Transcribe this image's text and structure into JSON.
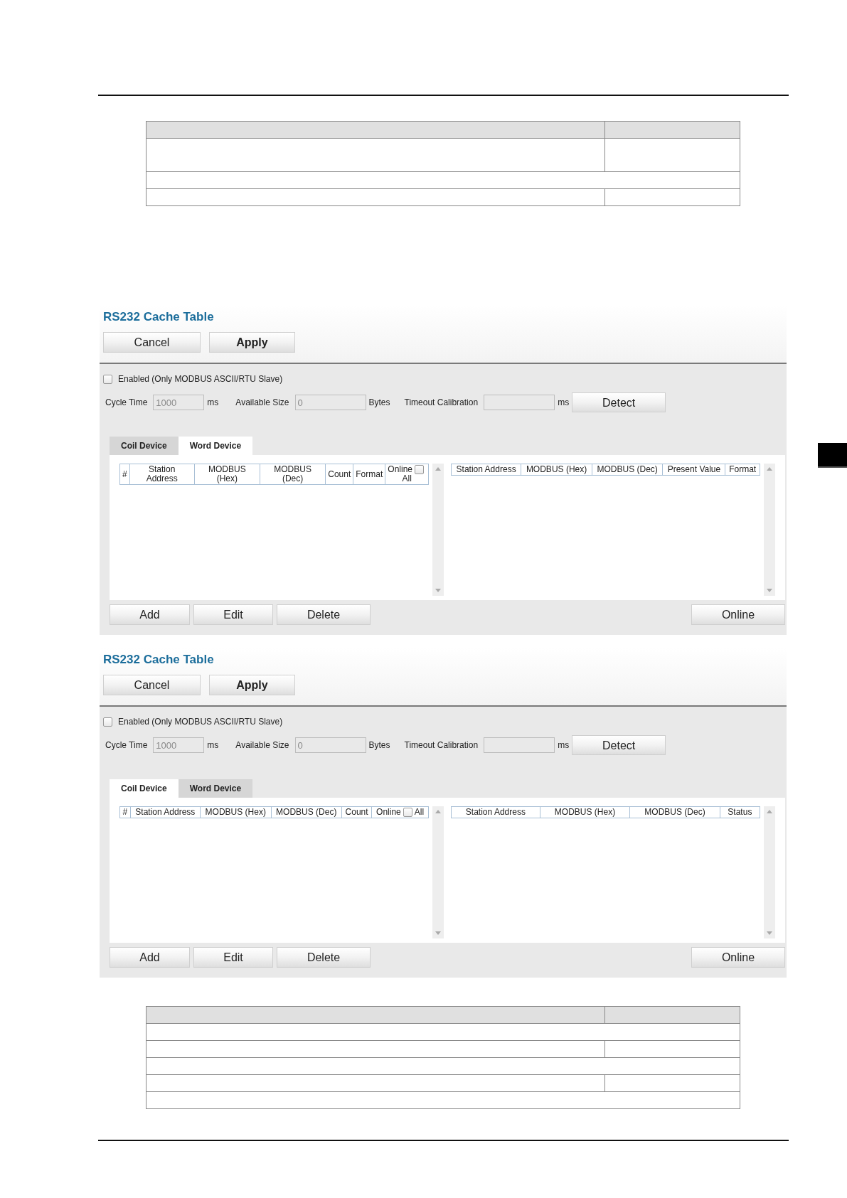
{
  "doc_tables": [
    {
      "rows": [
        {
          "kind": "header"
        },
        {
          "kind": "tall"
        },
        {
          "kind": "full"
        },
        {
          "kind": "split"
        }
      ]
    },
    {
      "rows": [
        {
          "kind": "header"
        },
        {
          "kind": "full"
        },
        {
          "kind": "split"
        },
        {
          "kind": "full"
        },
        {
          "kind": "split"
        },
        {
          "kind": "full"
        }
      ]
    }
  ],
  "panels": [
    {
      "title": "RS232 Cache Table",
      "top_buttons": [
        {
          "label": "Cancel",
          "primary": false
        },
        {
          "label": "Apply",
          "primary": true
        }
      ],
      "enabled": {
        "label": "Enabled (Only MODBUS ASCII/RTU Slave)",
        "checked": false
      },
      "fields": [
        {
          "label": "Cycle Time",
          "value": "1000",
          "unit": "ms"
        },
        {
          "label": "Available Size",
          "value": "0",
          "unit": "Bytes"
        },
        {
          "label": "Timeout Calibration",
          "unit": "ms"
        }
      ],
      "detect_button": "Detect",
      "tabs": [
        {
          "label": "Coil Device",
          "selected": false
        },
        {
          "label": "Word Device",
          "selected": true
        }
      ],
      "left_columns": [
        {
          "kind": "text",
          "label": "#"
        },
        {
          "kind": "text",
          "label": "Station Address"
        },
        {
          "kind": "text",
          "label": "MODBUS (Hex)"
        },
        {
          "kind": "text",
          "label": "MODBUS (Dec)"
        },
        {
          "kind": "text",
          "label": "Count"
        },
        {
          "kind": "text",
          "label": "Format"
        },
        {
          "kind": "check",
          "label": "Online",
          "after": "All",
          "checked": false,
          "stacked": true
        }
      ],
      "right_columns": [
        {
          "label": "Station Address"
        },
        {
          "label": "MODBUS (Hex)"
        },
        {
          "label": "MODBUS (Dec)"
        },
        {
          "label": "Present Value"
        },
        {
          "label": "Format"
        }
      ],
      "bottom_buttons": [
        "Add",
        "Edit",
        "Delete"
      ],
      "online_button": "Online"
    },
    {
      "title": "RS232 Cache Table",
      "top_buttons": [
        {
          "label": "Cancel",
          "primary": false
        },
        {
          "label": "Apply",
          "primary": true
        }
      ],
      "enabled": {
        "label": "Enabled (Only MODBUS ASCII/RTU Slave)",
        "checked": false
      },
      "fields": [
        {
          "label": "Cycle Time",
          "value": "1000",
          "unit": "ms"
        },
        {
          "label": "Available Size",
          "value": "0",
          "unit": "Bytes"
        },
        {
          "label": "Timeout Calibration",
          "unit": "ms"
        }
      ],
      "detect_button": "Detect",
      "tabs": [
        {
          "label": "Coil Device",
          "selected": true
        },
        {
          "label": "Word Device",
          "selected": false
        }
      ],
      "left_columns": [
        {
          "kind": "text",
          "label": "#"
        },
        {
          "kind": "text",
          "label": "Station Address"
        },
        {
          "kind": "text",
          "label": "MODBUS (Hex)"
        },
        {
          "kind": "text",
          "label": "MODBUS (Dec)"
        },
        {
          "kind": "text",
          "label": "Count"
        },
        {
          "kind": "check",
          "label": "Online",
          "after": "All",
          "checked": false,
          "stacked": false
        }
      ],
      "right_columns": [
        {
          "label": "Station Address"
        },
        {
          "label": "MODBUS (Hex)"
        },
        {
          "label": "MODBUS (Dec)"
        },
        {
          "label": "Status"
        }
      ],
      "bottom_buttons": [
        "Add",
        "Edit",
        "Delete"
      ],
      "online_button": "Online"
    }
  ]
}
